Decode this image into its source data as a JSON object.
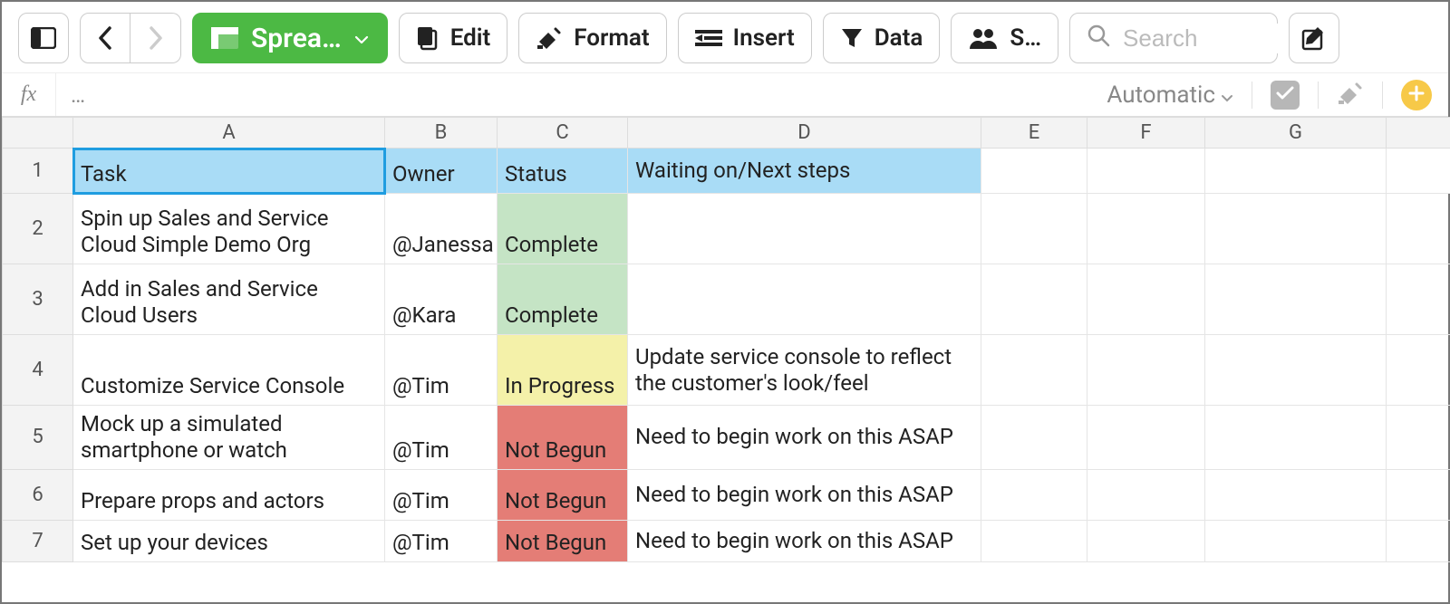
{
  "toolbar": {
    "view_label": "Sprea…",
    "edit_label": "Edit",
    "format_label": "Format",
    "insert_label": "Insert",
    "data_label": "Data",
    "share_label": "S…",
    "search_placeholder": "Search"
  },
  "formula_bar": {
    "fx_label": "fx",
    "content": "…",
    "calc_mode": "Automatic"
  },
  "columns": [
    "A",
    "B",
    "C",
    "D",
    "E",
    "F",
    "G"
  ],
  "header": {
    "A": "Task",
    "B": "Owner",
    "C": "Status",
    "D": "Waiting on/Next steps"
  },
  "rows": [
    {
      "n": "1"
    },
    {
      "n": "2",
      "A": "Spin up Sales and Service Cloud Simple Demo Org",
      "B": "@Janessa",
      "C": "Complete",
      "D": "",
      "status": "complete"
    },
    {
      "n": "3",
      "A": "Add in Sales and Service Cloud Users",
      "B": "@Kara",
      "C": "Complete",
      "D": "",
      "status": "complete"
    },
    {
      "n": "4",
      "A": "Customize Service Console",
      "B": "@Tim",
      "C": "In Progress",
      "D": "Update service console to reflect the customer's look/feel",
      "status": "progress"
    },
    {
      "n": "5",
      "A": "Mock up a simulated smartphone or watch",
      "B": "@Tim",
      "C": "Not Begun",
      "D": "Need to begin work on this ASAP",
      "status": "notbegun"
    },
    {
      "n": "6",
      "A": "Prepare props and actors",
      "B": "@Tim",
      "C": "Not Begun",
      "D": "Need to begin work on this ASAP",
      "status": "notbegun"
    },
    {
      "n": "7",
      "A": "Set up your devices",
      "B": "@Tim",
      "C": "Not Begun",
      "D": "Need to begin work on this ASAP",
      "status": "notbegun"
    }
  ]
}
